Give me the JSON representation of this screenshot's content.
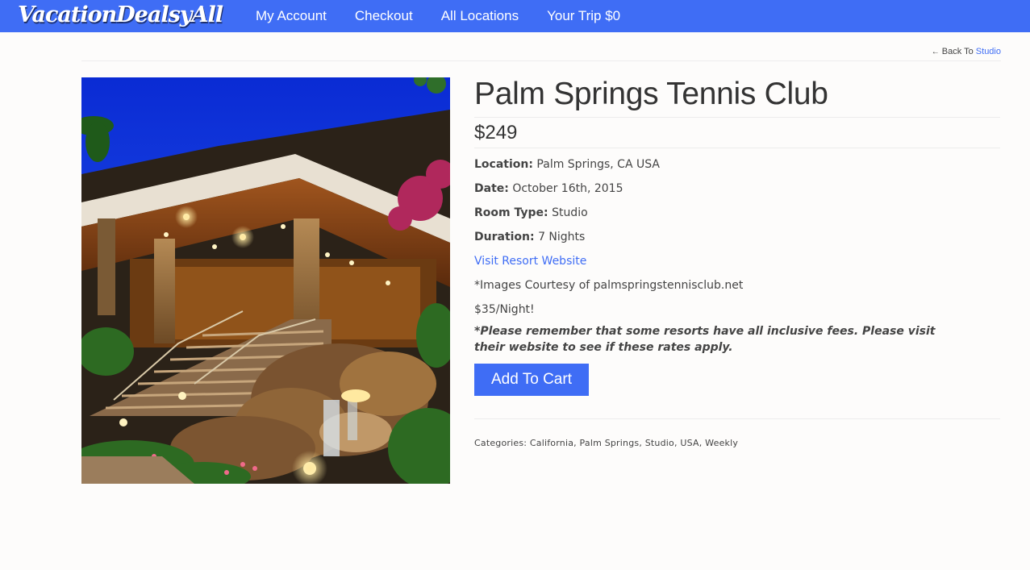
{
  "nav": {
    "logo": "VacationDealsyAll",
    "links": [
      "My Account",
      "Checkout",
      "All Locations",
      "Your Trip $0"
    ]
  },
  "back": {
    "prefix": "Back To",
    "link": "Studio"
  },
  "product": {
    "title": "Palm Springs Tennis Club",
    "price": "$249",
    "specs": [
      {
        "label": "Location:",
        "value": "Palm Springs, CA USA"
      },
      {
        "label": "Date:",
        "value": "October 16th, 2015"
      },
      {
        "label": "Room Type:",
        "value": "Studio"
      },
      {
        "label": "Duration:",
        "value": "7 Nights"
      }
    ],
    "website_link": "Visit Resort Website",
    "credit": "*Images Courtesy of palmspringstennisclub.net",
    "nightly": "$35/Night!",
    "note": "*Please remember that some resorts have all inclusive fees. Please visit their website to see if these rates apply.",
    "add_to_cart": "Add To Cart",
    "categories_label": "Categories:",
    "categories": [
      "California",
      "Palm Springs",
      "Studio",
      "USA",
      "Weekly"
    ]
  },
  "colors": {
    "brand": "#3f6df5",
    "text": "#333333"
  }
}
